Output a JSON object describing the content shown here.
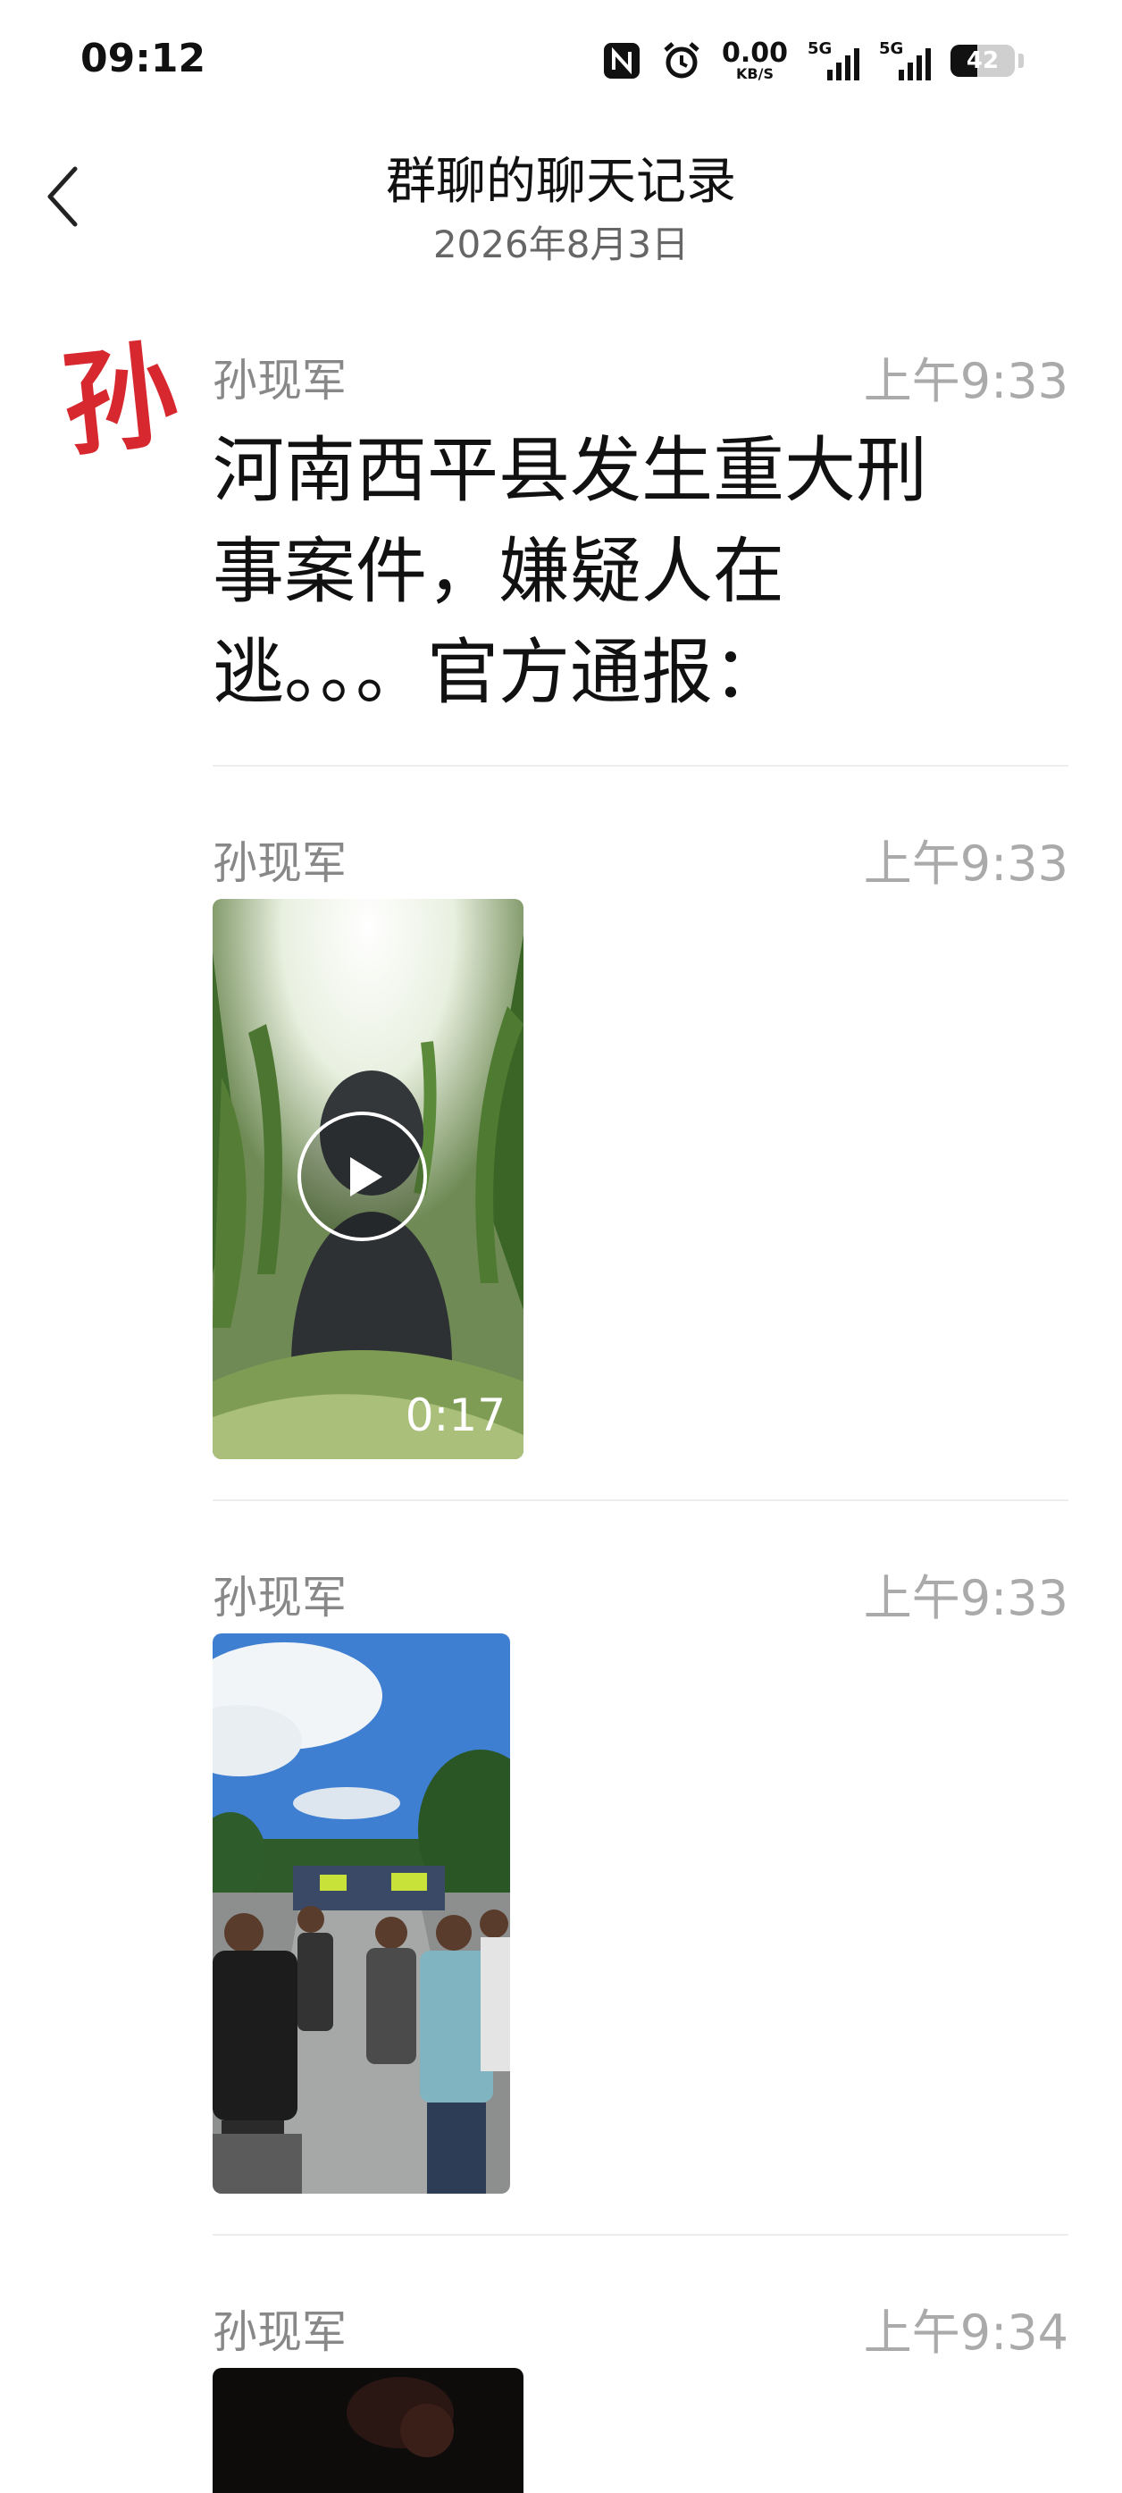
{
  "status": {
    "time": "09:12",
    "net_speed_value": "0.00",
    "net_speed_unit": "KB/S",
    "sim1_tag": "5G",
    "sim2_tag": "5G",
    "battery": "42"
  },
  "header": {
    "title": "群聊的聊天记录",
    "date": "2026年8月3日"
  },
  "avatar_char": "孙",
  "messages": [
    {
      "sender": "孙现军",
      "time": "上午9:33",
      "text": "河南西平县发生重大刑事案件，嫌疑人在逃。。。官方通报："
    },
    {
      "sender": "孙现军",
      "time": "上午9:33",
      "media_type": "video",
      "duration": "0:17"
    },
    {
      "sender": "孙现军",
      "time": "上午9:33",
      "media_type": "image"
    },
    {
      "sender": "孙现军",
      "time": "上午9:34",
      "media_type": "video"
    }
  ],
  "colors": {
    "avatar_red": "#d7282f",
    "name_gray": "#888888",
    "time_gray": "#aaaaaa"
  }
}
